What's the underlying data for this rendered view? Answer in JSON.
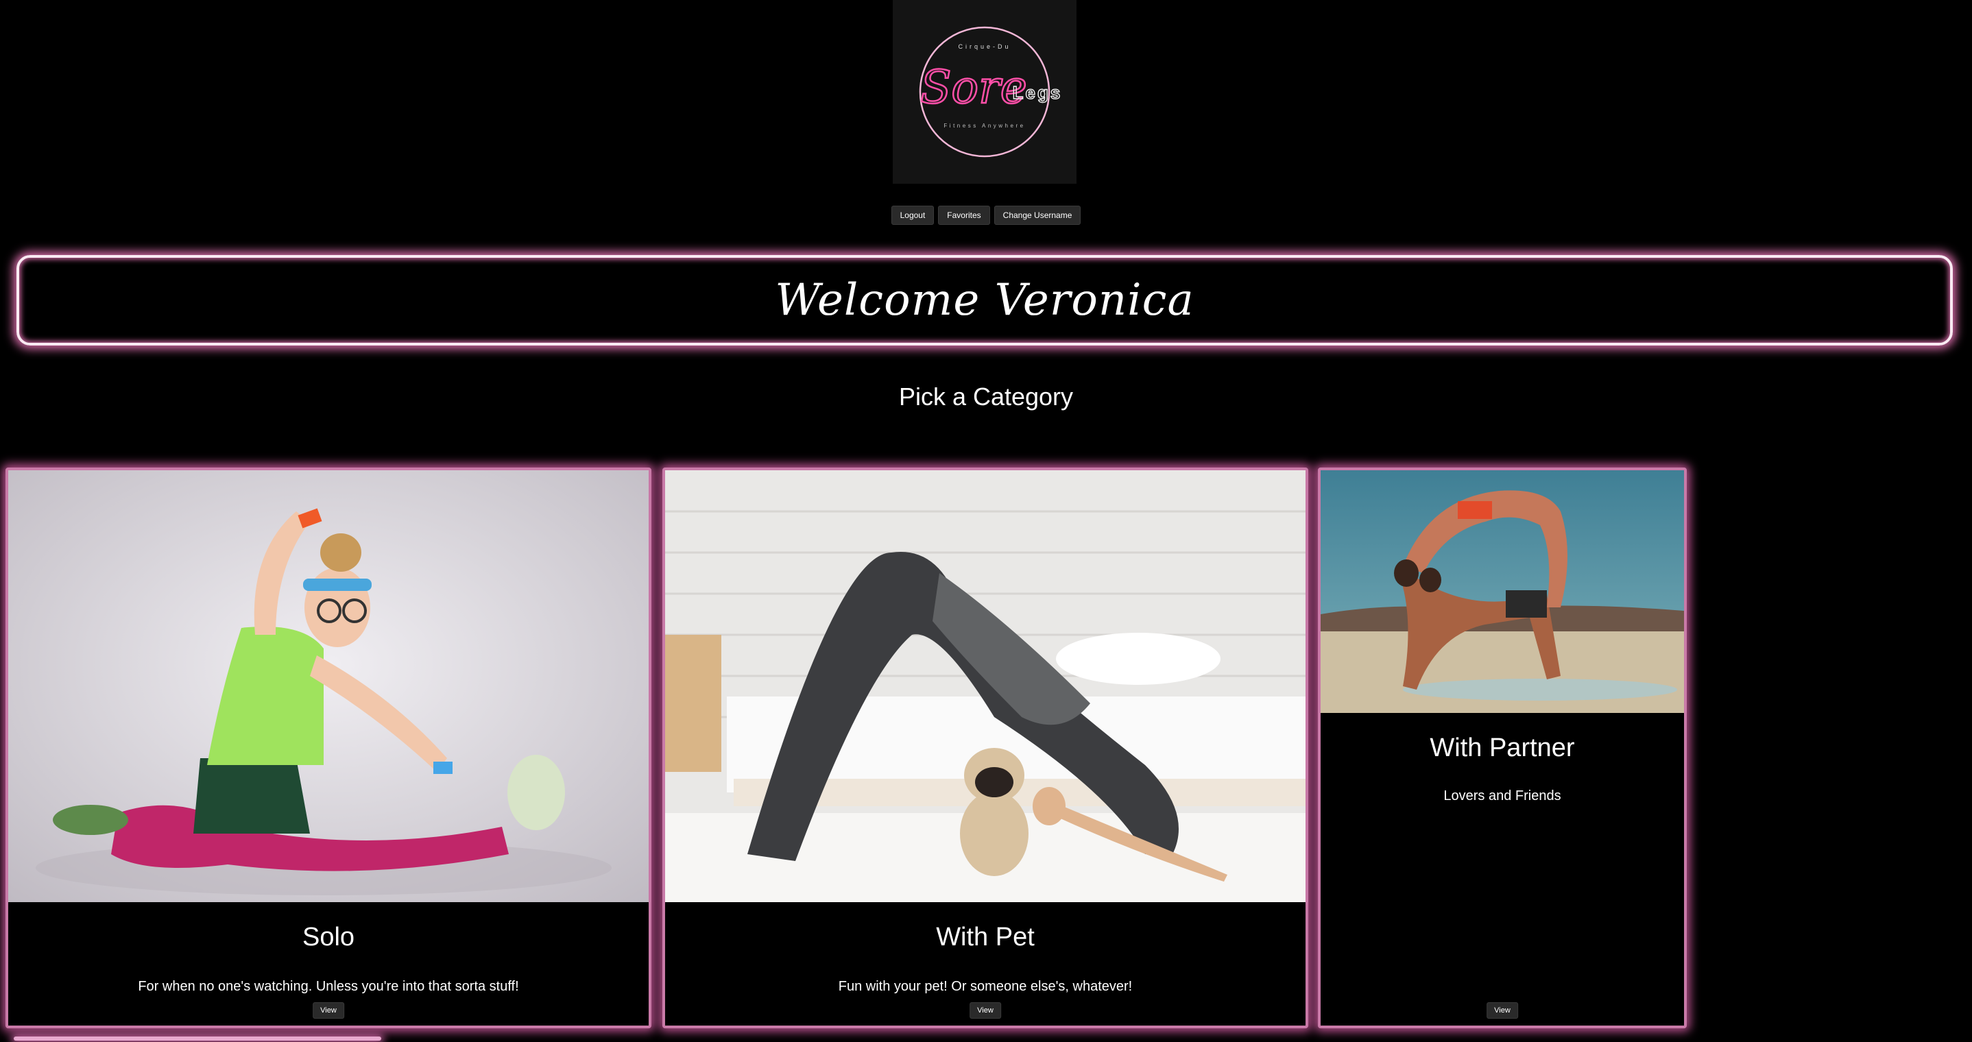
{
  "logo": {
    "top_text": "Cirque-Du",
    "script_text": "Sore",
    "block_text": "Legs",
    "bottom_text": "Fitness Anywhere"
  },
  "nav": {
    "logout": "Logout",
    "favorites": "Favorites",
    "change_username": "Change Username"
  },
  "welcome": "Welcome Veronica",
  "heading": "Pick a Category",
  "cards": [
    {
      "title": "Solo",
      "text": "For when no one's watching. Unless you're into that sorta stuff!",
      "button": "View",
      "image": "woman-stretching-photo"
    },
    {
      "title": "With Pet",
      "text": "Fun with your pet! Or someone else's, whatever!",
      "button": "View",
      "image": "woman-yoga-with-pug-photo"
    },
    {
      "title": "With Partner",
      "text": "Lovers and Friends",
      "button": "View",
      "image": "partner-acrobatics-beach-photo"
    }
  ],
  "colors": {
    "background": "#000000",
    "neon_pink": "#d46aa6",
    "card_border": "#c97aa8",
    "button_bg": "#2a2a2a"
  }
}
